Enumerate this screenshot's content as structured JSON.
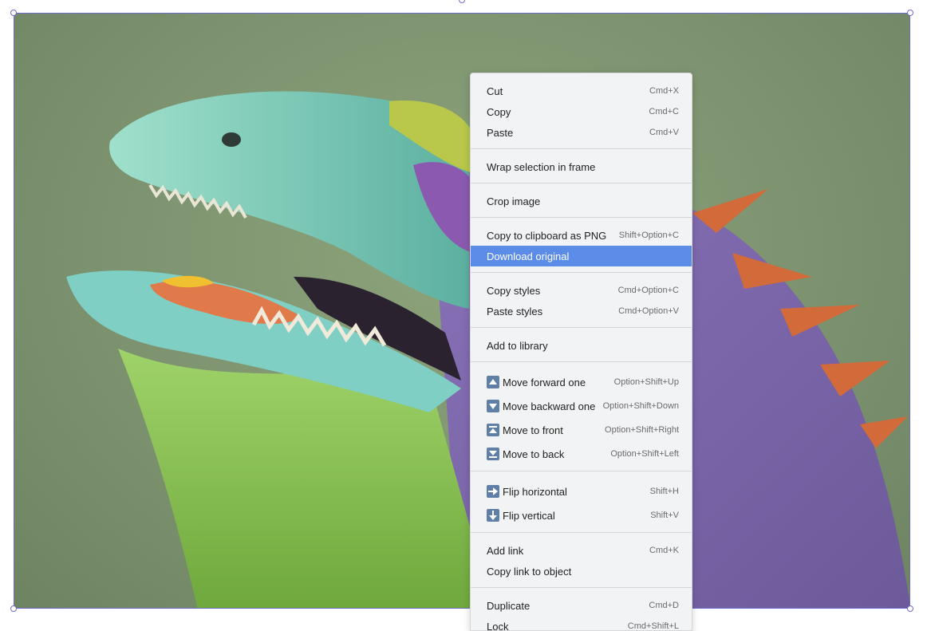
{
  "context_menu": {
    "items": [
      {
        "label": "Cut",
        "shortcut": "Cmd+X"
      },
      {
        "label": "Copy",
        "shortcut": "Cmd+C"
      },
      {
        "label": "Paste",
        "shortcut": "Cmd+V"
      },
      {
        "label": "Wrap selection in frame",
        "shortcut": ""
      },
      {
        "label": "Crop image",
        "shortcut": ""
      },
      {
        "label": "Copy to clipboard as PNG",
        "shortcut": "Shift+Option+C"
      },
      {
        "label": "Download original",
        "shortcut": "",
        "highlighted": true
      },
      {
        "label": "Copy styles",
        "shortcut": "Cmd+Option+C"
      },
      {
        "label": "Paste styles",
        "shortcut": "Cmd+Option+V"
      },
      {
        "label": "Add to library",
        "shortcut": ""
      },
      {
        "label": "Move forward one",
        "shortcut": "Option+Shift+Up",
        "icon": "arrow-up-icon"
      },
      {
        "label": "Move backward one",
        "shortcut": "Option+Shift+Down",
        "icon": "arrow-down-icon"
      },
      {
        "label": "Move to front",
        "shortcut": "Option+Shift+Right",
        "icon": "bring-to-front-icon"
      },
      {
        "label": "Move to back",
        "shortcut": "Option+Shift+Left",
        "icon": "send-to-back-icon"
      },
      {
        "label": "Flip horizontal",
        "shortcut": "Shift+H",
        "icon": "flip-horizontal-icon"
      },
      {
        "label": "Flip vertical",
        "shortcut": "Shift+V",
        "icon": "flip-vertical-icon"
      },
      {
        "label": "Add link",
        "shortcut": "Cmd+K"
      },
      {
        "label": "Copy link to object",
        "shortcut": ""
      },
      {
        "label": "Duplicate",
        "shortcut": "Cmd+D"
      },
      {
        "label": "Lock",
        "shortcut": "Cmd+Shift+L"
      }
    ]
  },
  "colors": {
    "selection": "#6f6cc9",
    "highlight": "#5b8ce8",
    "menu_background": "#f2f3f5"
  }
}
